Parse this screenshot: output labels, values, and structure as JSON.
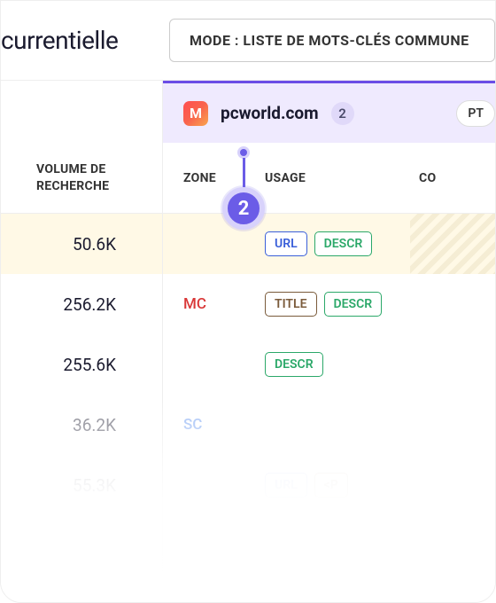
{
  "header": {
    "title_fragment": "currentielle",
    "mode_label": "MODE : LISTE DE MOTS-CLÉS COMMUNE"
  },
  "domain_panel": {
    "icon_letter": "M",
    "domain": "pcworld.com",
    "count": "2",
    "right_pill": "PT"
  },
  "columns": {
    "volume": "VOLUME DE RECHERCHE",
    "zone": "ZONE",
    "usage": "USAGE",
    "co": "CO"
  },
  "step_badge": "2",
  "tags": {
    "url": "URL",
    "descr": "DESCR",
    "title": "TITLE",
    "p_frag": "<P"
  },
  "zones": {
    "mc": "MC",
    "sc": "SC"
  },
  "rows": [
    {
      "volume": "50.6K",
      "zone": "",
      "usage": [
        "url",
        "descr"
      ],
      "highlight": true,
      "striped": true
    },
    {
      "volume": "256.2K",
      "zone": "mc",
      "usage": [
        "title",
        "descr"
      ]
    },
    {
      "volume": "255.6K",
      "zone": "",
      "usage": [
        "descr"
      ]
    },
    {
      "volume": "36.2K",
      "zone": "sc",
      "usage": []
    },
    {
      "volume": "55.3K",
      "zone": "",
      "usage": [
        "url",
        "p_frag"
      ]
    }
  ]
}
